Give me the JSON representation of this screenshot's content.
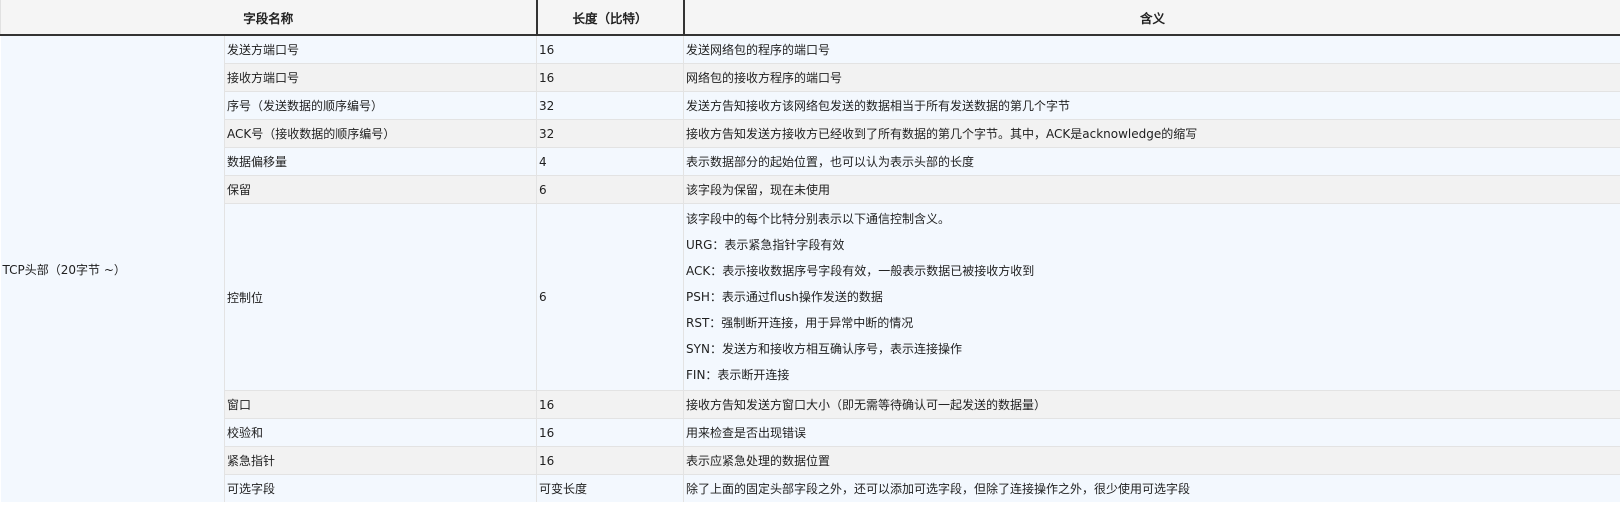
{
  "headers": {
    "field_name": "字段名称",
    "length": "长度（比特）",
    "meaning": "含义"
  },
  "group_label": "TCP头部（20字节 ~）",
  "rows": [
    {
      "name": "发送方端口号",
      "length": "16",
      "meaning": "发送网络包的程序的端口号"
    },
    {
      "name": "接收方端口号",
      "length": "16",
      "meaning": "网络包的接收方程序的端口号"
    },
    {
      "name": "序号（发送数据的顺序编号）",
      "length": "32",
      "meaning": "发送方告知接收方该网络包发送的数据相当于所有发送数据的第几个字节"
    },
    {
      "name": "ACK号（接收数据的顺序编号）",
      "length": "32",
      "meaning": "接收方告知发送方接收方已经收到了所有数据的第几个字节。其中，ACK是acknowledge的缩写"
    },
    {
      "name": "数据偏移量",
      "length": "4",
      "meaning": "表示数据部分的起始位置，也可以认为表示头部的长度"
    },
    {
      "name": "保留",
      "length": "6",
      "meaning": "该字段为保留，现在未使用"
    },
    {
      "name": "控制位",
      "length": "6",
      "meaning_lines": [
        "该字段中的每个比特分别表示以下通信控制含义。",
        "URG：表示紧急指针字段有效",
        "ACK：表示接收数据序号字段有效，一般表示数据已被接收方收到",
        "PSH：表示通过flush操作发送的数据",
        "RST：强制断开连接，用于异常中断的情况",
        "SYN：发送方和接收方相互确认序号，表示连接操作",
        "FIN：表示断开连接"
      ]
    },
    {
      "name": "窗口",
      "length": "16",
      "meaning": "接收方告知发送方窗口大小（即无需等待确认可一起发送的数据量）"
    },
    {
      "name": "校验和",
      "length": "16",
      "meaning": "用来检查是否出现错误"
    },
    {
      "name": "紧急指针",
      "length": "16",
      "meaning": "表示应紧急处理的数据位置"
    },
    {
      "name": "可选字段",
      "length": "可变长度",
      "meaning": "除了上面的固定头部字段之外，还可以添加可选字段，但除了连接操作之外，很少使用可选字段"
    }
  ]
}
